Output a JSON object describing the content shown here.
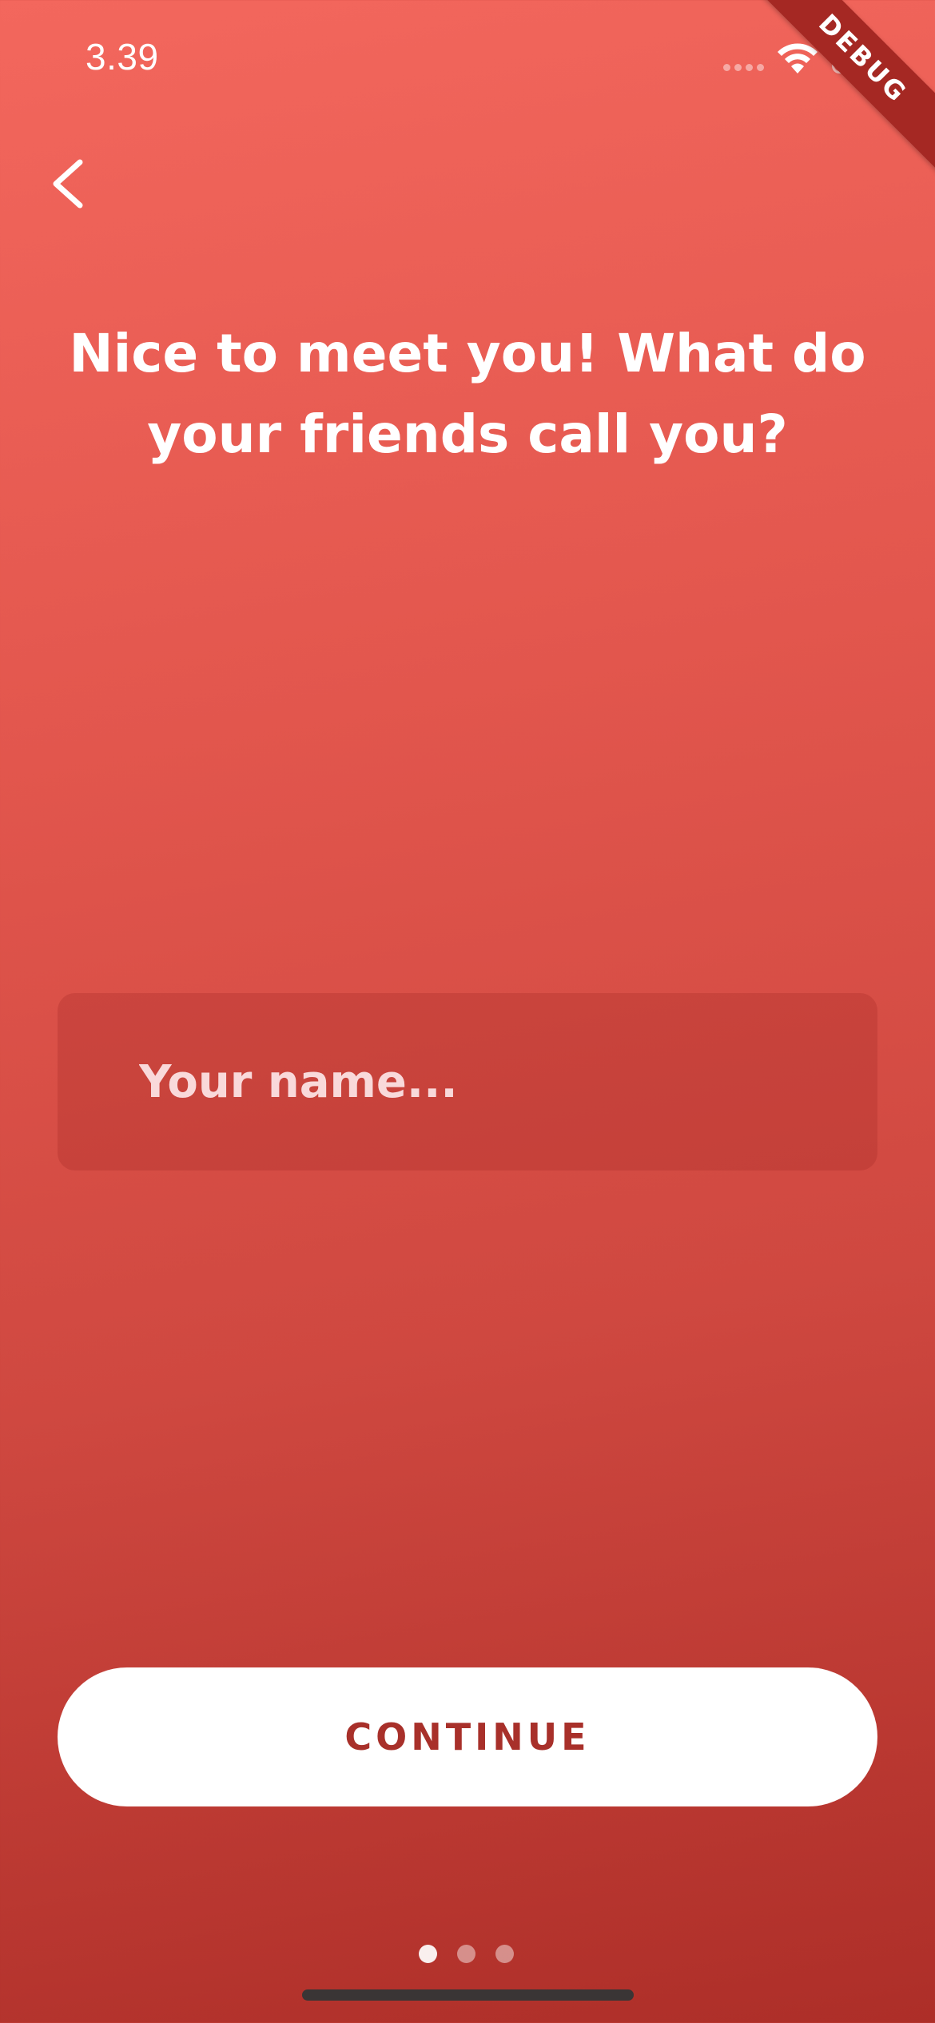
{
  "status_bar": {
    "time": "3.39",
    "icons": [
      "signal-dots-icon",
      "wifi-icon",
      "battery-icon"
    ]
  },
  "debug_banner": {
    "label": "DEBUG"
  },
  "navigation": {
    "back_icon": "chevron-left-icon"
  },
  "content": {
    "headline": "Nice to meet you! What do your friends call you?",
    "name_input": {
      "value": "",
      "placeholder": "Your name..."
    }
  },
  "actions": {
    "continue_label": "CONTINUE"
  },
  "pagination": {
    "total": 3,
    "current": 1
  },
  "colors": {
    "gradient_top": "#f3675d",
    "gradient_bottom": "#ad2e28",
    "button_text": "#a8302a",
    "ribbon": "#a52823"
  }
}
